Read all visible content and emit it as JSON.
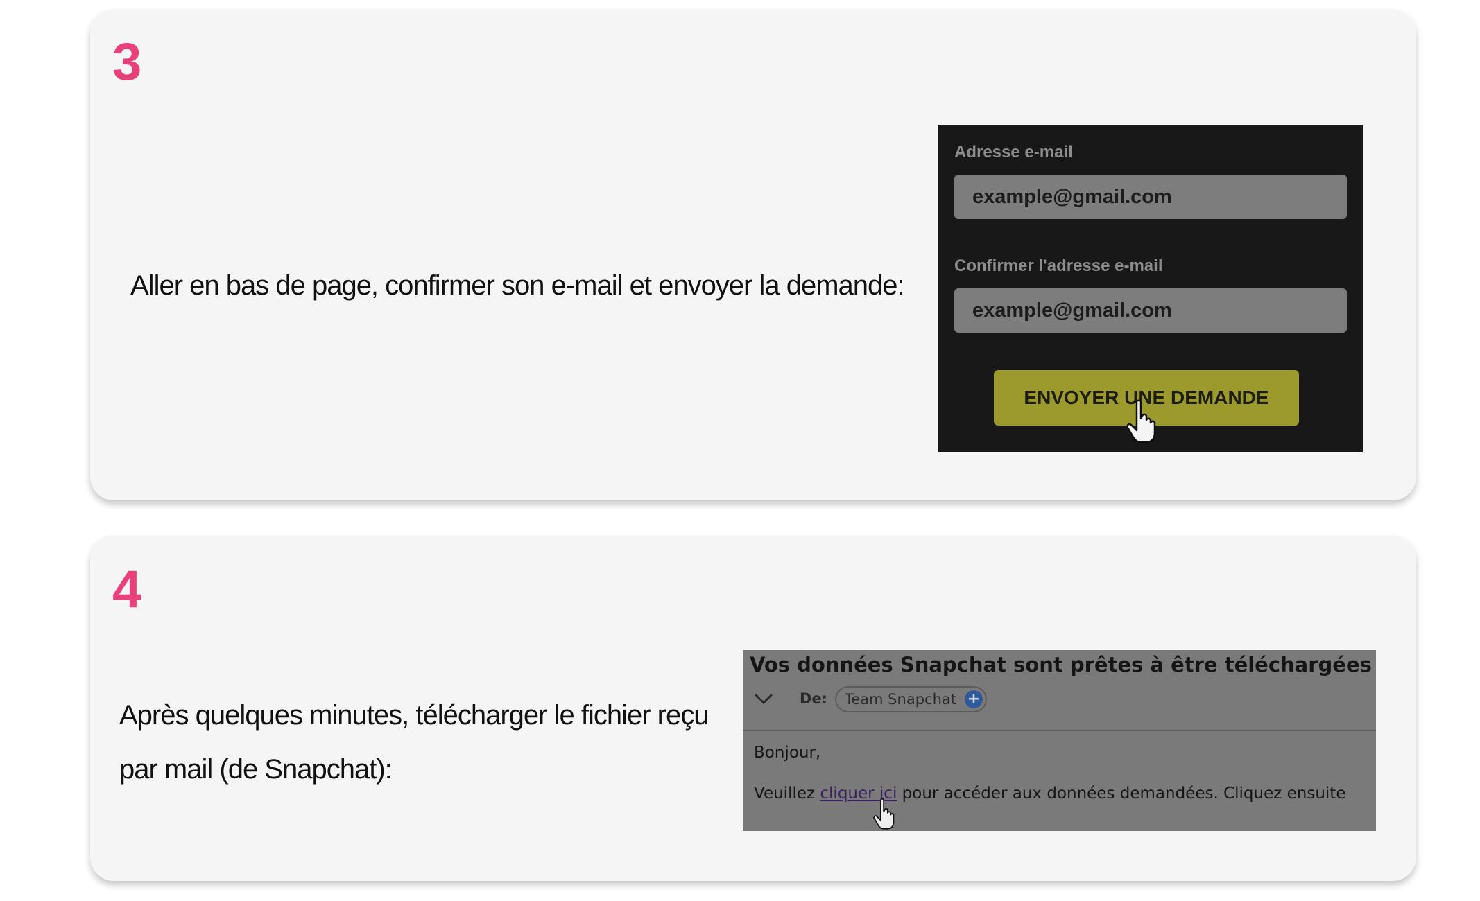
{
  "steps": [
    {
      "number": "3",
      "instruction": "Aller en bas de page, confirmer son e-mail et envoyer la demande:",
      "screenshot": {
        "email_label": "Adresse e-mail",
        "email_value": "example@gmail.com",
        "confirm_label": "Confirmer l'adresse e-mail",
        "confirm_value": "example@gmail.com",
        "submit_label": "ENVOYER UNE DEMANDE"
      }
    },
    {
      "number": "4",
      "instruction": "Après quelques minutes, télécharger le fichier reçu par mail (de Snapchat):",
      "screenshot": {
        "subject": "Vos données Snapchat sont prêtes à être téléchargées",
        "from_label": "De:",
        "sender": "Team Snapchat",
        "greeting": "Bonjour,",
        "body_prefix": "Veuillez",
        "link_text": "cliquer ici",
        "body_suffix": "pour accéder aux données demandées. Cliquez ensuite"
      }
    }
  ],
  "colors": {
    "accent": "#e8407a",
    "card_background": "#f5f5f5",
    "submit_button": "#9c9a2c"
  },
  "icons": {
    "cursor": "hand-pointer-icon",
    "expand": "chevron-down-icon",
    "add_contact": "plus-circle-icon"
  }
}
